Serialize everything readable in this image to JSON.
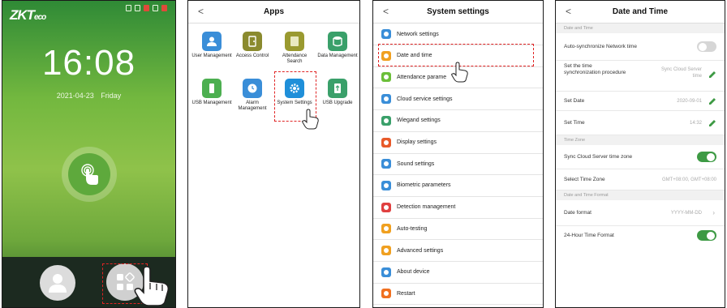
{
  "panel1": {
    "logo_main": "ZKT",
    "logo_sub": "eco",
    "time": "16:08",
    "date": "2021-04-23",
    "weekday": "Friday"
  },
  "panel2": {
    "title": "Apps",
    "back": "<",
    "apps": [
      {
        "label": "User Management",
        "color": "#3a8ed8"
      },
      {
        "label": "Access Control",
        "color": "#8a8a2e"
      },
      {
        "label": "Attendance Search",
        "color": "#9a9a30"
      },
      {
        "label": "Data Management",
        "color": "#3aa06a"
      },
      {
        "label": "USB Management",
        "color": "#4caf50"
      },
      {
        "label": "Alarm Management",
        "color": "#3a8ed8"
      },
      {
        "label": "System Settings",
        "color": "#1f8fd9"
      },
      {
        "label": "USB Upgrade",
        "color": "#3aa06a"
      }
    ]
  },
  "panel3": {
    "title": "System settings",
    "back": "<",
    "items": [
      {
        "label": "Network settings",
        "color": "#3a8ed8"
      },
      {
        "label": "Date and time",
        "color": "#f0a020"
      },
      {
        "label": "Attendance parame",
        "color": "#6cbf3a"
      },
      {
        "label": "Cloud service settings",
        "color": "#3a8ed8"
      },
      {
        "label": "Wiegand settings",
        "color": "#3aa06a"
      },
      {
        "label": "Display settings",
        "color": "#e85a2a"
      },
      {
        "label": "Sound settings",
        "color": "#3a8ed8"
      },
      {
        "label": "Biometric parameters",
        "color": "#3a8ed8"
      },
      {
        "label": "Detection management",
        "color": "#e04040"
      },
      {
        "label": "Auto-testing",
        "color": "#f0a020"
      },
      {
        "label": "Advanced settings",
        "color": "#f0a020"
      },
      {
        "label": "About device",
        "color": "#3a8ed8"
      },
      {
        "label": "Restart",
        "color": "#f07020"
      }
    ]
  },
  "panel4": {
    "title": "Date and Time",
    "back": "<",
    "section_datetime": "Date and Time",
    "auto_sync_label": "Auto-synchronize Network time",
    "auto_sync_on": false,
    "sync_proc_label": "Set the time synchronization procedure",
    "sync_proc_value": "Sync Cloud Server time",
    "set_date_label": "Set Date",
    "set_date_value": "2020-09-01",
    "set_time_label": "Set Time",
    "set_time_value": "14:32",
    "section_timezone": "Time Zone",
    "sync_tz_label": "Sync Cloud Server time zone",
    "sync_tz_on": true,
    "select_tz_label": "Select Time Zone",
    "select_tz_value": "GMT+08:00, GMT+08:00",
    "section_format": "Date and Time Format",
    "date_format_label": "Date format",
    "date_format_value": "YYYY-MM-DD",
    "hour24_label": "24-Hour Time Format",
    "hour24_on": true
  },
  "colors": {
    "accent_green": "#3d9a44",
    "highlight_red": "#e02424"
  }
}
